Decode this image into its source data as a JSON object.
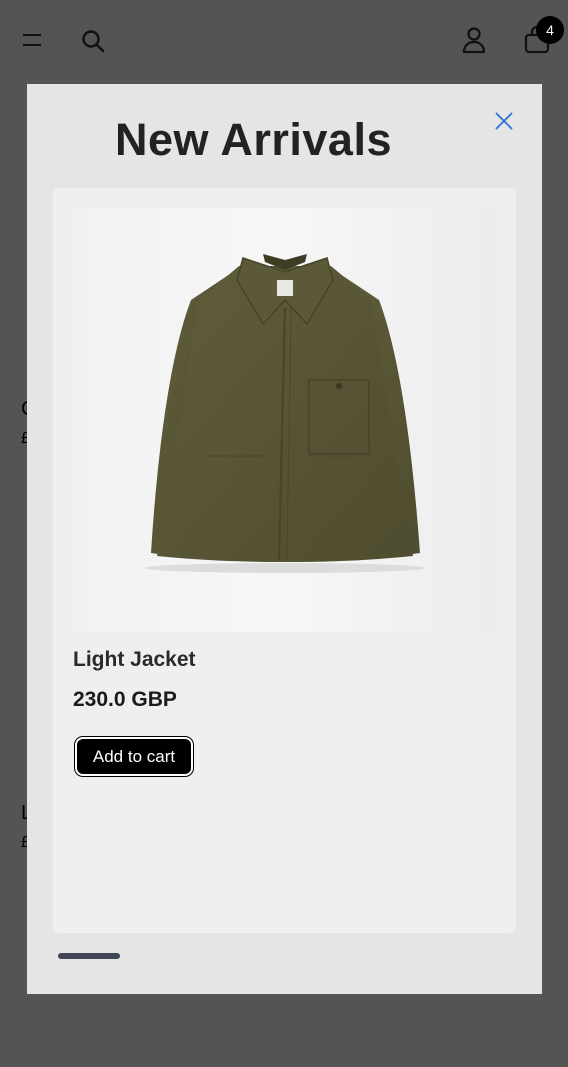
{
  "header": {
    "cart_count": "4",
    "icons": {
      "menu": "hamburger-menu-icon",
      "search": "search-icon",
      "account": "user-icon",
      "cart": "shopping-bag-icon"
    }
  },
  "background": {
    "fragments": [
      "C",
      "£",
      "L",
      "£"
    ]
  },
  "modal": {
    "title": "New Arrivals",
    "close_icon": "close-icon",
    "product": {
      "name": "Light Jacket",
      "price": "230.0 GBP",
      "add_to_cart_label": "Add to cart",
      "image": "olive-green-jacket"
    }
  },
  "colors": {
    "overlay": "#545454",
    "modal_bg": "#e5e5e5",
    "card_bg": "#efefef",
    "button_bg": "#000000",
    "close_accent": "#2f6fd6",
    "jacket": "#5a5836",
    "scrollbar": "#3f4556"
  }
}
